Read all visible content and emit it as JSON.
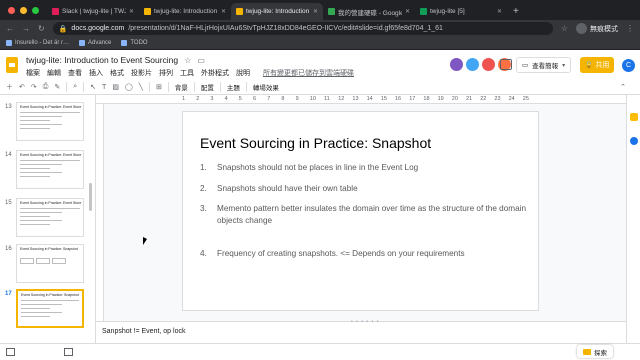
{
  "browser": {
    "tabs": [
      {
        "label": "Slack | twjug-lite | TWJUG",
        "color": "#e01e5a",
        "active": false
      },
      {
        "label": "twjug-lite: Introduction to Even",
        "color": "#f4b400",
        "active": false
      },
      {
        "label": "twjug-lite: Introduction to Even",
        "color": "#f4b400",
        "active": true
      },
      {
        "label": "我的營建硬碟 - Google 雲端硬碟",
        "color": "#34a853",
        "active": false
      },
      {
        "label": "twjug-lite [5]",
        "color": "#0f9d58",
        "active": false
      }
    ],
    "address": {
      "host": "docs.google.com",
      "path": "/presentation/d/1NaF-HLjrHojxUIAu6StvTpHJZ18xDD84eGEO-IICVc/edit#slide=id.gf65fe8d704_1_61"
    },
    "incognito_label": "無痕模式",
    "bookmarks": [
      "Insurello - Det är r…",
      "Advance",
      "TODO"
    ]
  },
  "slides_app": {
    "doc_title": "twjug-lite: Introduction to Event Sourcing",
    "menu": [
      "檔案",
      "編輯",
      "查看",
      "插入",
      "格式",
      "投影片",
      "排列",
      "工具",
      "外掛程式",
      "說明"
    ],
    "saved_status": "所有變更都已儲存到雲端硬碟",
    "present_label": "查看簡報",
    "share_label": "共用",
    "account_initial": "C"
  },
  "toolbar": {
    "labels": [
      "背景",
      "配置",
      "主題",
      "轉場效果"
    ]
  },
  "filmstrip": {
    "thumbnails": [
      {
        "number": "13",
        "title": "Event Sourcing in Practice: Event Store",
        "selected": false
      },
      {
        "number": "14",
        "title": "Event Sourcing in Practice: Event Store",
        "selected": false
      },
      {
        "number": "15",
        "title": "Event Sourcing in Practice: Event Store",
        "selected": false
      },
      {
        "number": "16",
        "title": "Event Sourcing in Practice: Snapshot",
        "selected": false
      },
      {
        "number": "17",
        "title": "Event Sourcing in Practice: Snapshot",
        "selected": true
      }
    ]
  },
  "ruler": {
    "ticks": [
      "1",
      "2",
      "3",
      "4",
      "5",
      "6",
      "7",
      "8",
      "9",
      "10",
      "11",
      "12",
      "13",
      "14",
      "15",
      "16",
      "17",
      "18",
      "19",
      "20",
      "21",
      "22",
      "23",
      "24",
      "25"
    ]
  },
  "slide": {
    "title": "Event Sourcing in Practice: Snapshot",
    "bullets": [
      {
        "n": "1.",
        "text": "Snapshots should not be places in line in the Event Log"
      },
      {
        "n": "2.",
        "text": "Snapshots should have their own table"
      },
      {
        "n": "3.",
        "text": "Memento pattern better insulates the domain over time as the structure of the domain objects change"
      },
      {
        "n": "4.",
        "text": "Frequency of creating snapshots. <= Depends on your requirements"
      }
    ]
  },
  "notes": {
    "text": "Sanpshot != Event, op lock"
  },
  "explore_label": "探索"
}
